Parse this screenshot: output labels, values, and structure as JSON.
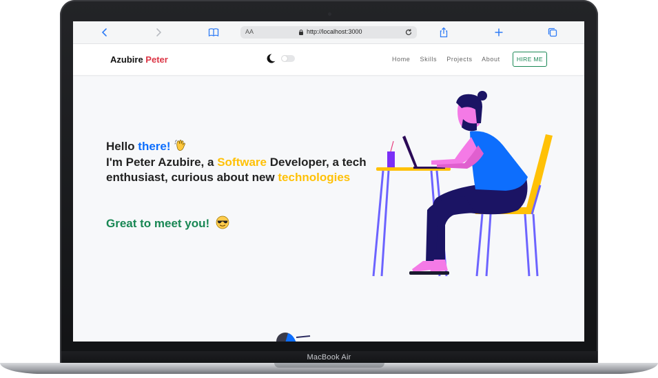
{
  "device": {
    "label": "MacBook Air"
  },
  "browser": {
    "text_size_label": "AA",
    "url": "http://localhost:3000"
  },
  "site": {
    "logo_first": "Azubire",
    "logo_second": "Peter",
    "nav": [
      "Home",
      "Skills",
      "Projects",
      "About"
    ],
    "cta": "HIRE ME"
  },
  "hero": {
    "hello": "Hello",
    "there": "there!",
    "intro": "I'm Peter Azubire, a",
    "software": "Software",
    "dev": "Developer, a tech enthusiast, curious about new",
    "tech": "technologies",
    "greeting": "Great to meet you!"
  },
  "colors": {
    "accent_red": "#dc3545",
    "accent_blue": "#0d6efd",
    "accent_yellow": "#ffc107",
    "accent_green": "#198754"
  }
}
